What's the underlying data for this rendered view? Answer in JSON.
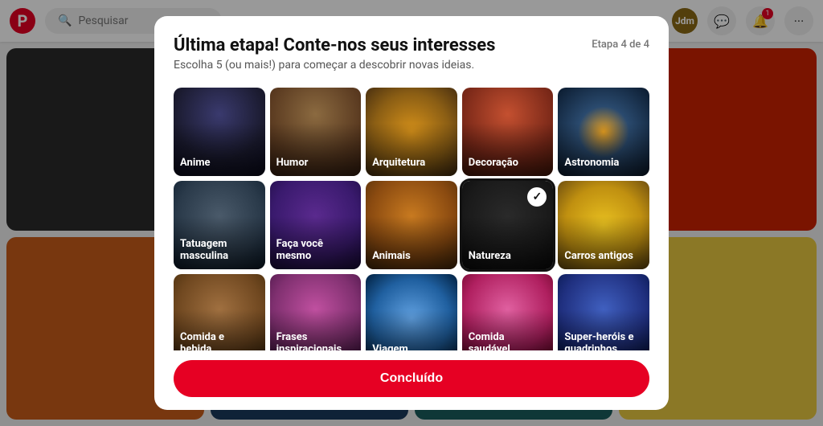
{
  "app": {
    "logo_symbol": "P",
    "logo_alt": "Pinterest"
  },
  "navbar": {
    "search_placeholder": "Pesquisar",
    "user_initials": "Jdm",
    "notification_count": "1",
    "icons": {
      "search": "🔍",
      "message": "💬",
      "bell": "🔔",
      "more": "···"
    }
  },
  "modal": {
    "title": "Última etapa! Conte-nos seus interesses",
    "subtitle": "Escolha 5 (ou mais!) para começar a descobrir novas ideias.",
    "step": "Etapa 4 de 4",
    "done_button": "Concluído",
    "interests": [
      {
        "id": "anime",
        "label": "Anime",
        "selected": false,
        "bg_color": "#1a1a2e",
        "bg_gradient": "linear-gradient(135deg, #1a1a2e 0%, #16213e 100%)"
      },
      {
        "id": "humor",
        "label": "Humor",
        "selected": false,
        "bg_color": "#5a3a1a",
        "bg_gradient": "linear-gradient(135deg, #6b4c2a 0%, #4a3018 100%)"
      },
      {
        "id": "arquitetura",
        "label": "Arquitetura",
        "selected": false,
        "bg_color": "#8B6914",
        "bg_gradient": "linear-gradient(135deg, #c47c2a 0%, #8B5e14 100%)"
      },
      {
        "id": "decoracao",
        "label": "Decoração",
        "selected": false,
        "bg_color": "#8b3a14",
        "bg_gradient": "linear-gradient(135deg, #9b4a24 0%, #6b2a14 100%)"
      },
      {
        "id": "astronomia",
        "label": "Astronomia",
        "selected": false,
        "bg_color": "#1a1a4e",
        "bg_gradient": "linear-gradient(135deg, #2a2a5e 0%, #0a0a2e 100%)"
      },
      {
        "id": "tatuagem",
        "label": "Tatuagem masculina",
        "selected": false,
        "bg_color": "#2a3a4a",
        "bg_gradient": "linear-gradient(135deg, #3a4a5a 0%, #1a2a3a 100%)"
      },
      {
        "id": "facavoce",
        "label": "Faça você mesmo",
        "selected": false,
        "bg_color": "#1a1a4e",
        "bg_gradient": "linear-gradient(135deg, #2a0a5e 0%, #1a0a3e 100%)"
      },
      {
        "id": "animais",
        "label": "Animais",
        "selected": false,
        "bg_color": "#8b5e14",
        "bg_gradient": "linear-gradient(135deg, #c47c2a 0%, #6b4a14 100%)"
      },
      {
        "id": "natureza",
        "label": "Natureza",
        "selected": true,
        "bg_color": "#1a1a1a",
        "bg_gradient": "linear-gradient(135deg, #2a2a2a 0%, #0a0a0a 100%)"
      },
      {
        "id": "carros",
        "label": "Carros antigos",
        "selected": false,
        "bg_color": "#8b6a14",
        "bg_gradient": "linear-gradient(135deg, #d4a020 0%, #8b6014 100%)"
      },
      {
        "id": "comidabebida",
        "label": "Comida e bebida",
        "selected": false,
        "bg_color": "#5a3a1a",
        "bg_gradient": "linear-gradient(135deg, #8b5a2a 0%, #4a2a14 100%)"
      },
      {
        "id": "frases",
        "label": "Frases inspiracionais",
        "selected": false,
        "bg_color": "#3a1a4e",
        "bg_gradient": "linear-gradient(135deg, #5a2a6e 0%, #2a0a3e 100%)"
      },
      {
        "id": "viagem",
        "label": "Viagem",
        "selected": false,
        "bg_color": "#1a3a5a",
        "bg_gradient": "linear-gradient(135deg, #2a5a8a 0%, #0a2a4a 100%)"
      },
      {
        "id": "comidasaudavel",
        "label": "Comida saudável",
        "selected": false,
        "bg_color": "#8b2a4a",
        "bg_gradient": "linear-gradient(135deg, #c43a6a 0%, #6b1a3a 100%)"
      },
      {
        "id": "super",
        "label": "Super-heróis e quadrinhos",
        "selected": false,
        "bg_color": "#1a2a5e",
        "bg_gradient": "linear-gradient(135deg, #2a3a7e 0%, #0a1a4e 100%)"
      }
    ]
  }
}
